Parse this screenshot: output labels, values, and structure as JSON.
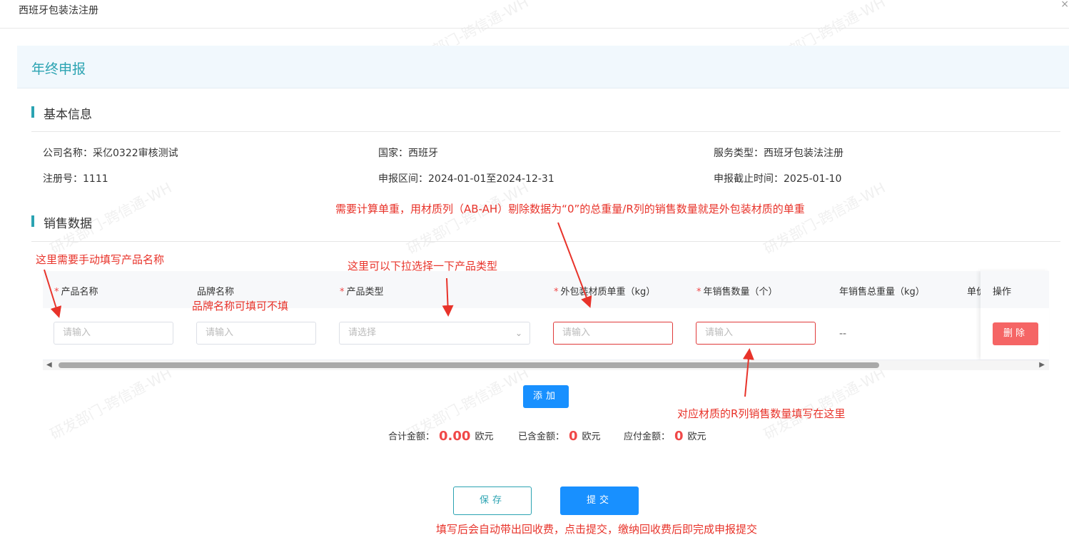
{
  "window": {
    "title": "西班牙包装法注册",
    "close_glyph": "×"
  },
  "banner": {
    "title": "年终申报"
  },
  "basic_info": {
    "heading": "基本信息",
    "company": "公司名称：采亿0322审核测试",
    "country": "国家：西班牙",
    "service_type": "服务类型：西班牙包装法注册",
    "reg_no": "注册号：1111",
    "period": "申报区间：2024-01-01至2024-12-31",
    "deadline": "申报截止时间：2025-01-10"
  },
  "sales": {
    "heading": "销售数据",
    "required_mark": "*",
    "columns": {
      "product_name": "产品名称",
      "brand_name": "品牌名称",
      "product_type": "产品类型",
      "unit_weight": "外包装材质单重（kg）",
      "annual_qty": "年销售数量（个）",
      "annual_total_weight": "年销售总重量（kg）",
      "unit_price_partial": "单价",
      "operation": "操作"
    },
    "row": {
      "product_name_placeholder": "请输入",
      "brand_name_placeholder": "请输入",
      "product_type_placeholder": "请选择",
      "unit_weight_placeholder": "请输入",
      "annual_qty_placeholder": "请输入",
      "total_weight_value": "--",
      "delete_label": "删除"
    },
    "add_label": "添加"
  },
  "totals": {
    "total_label": "合计金额：",
    "total_value": "0.00",
    "total_unit": "欧元",
    "included_label": "已含金额：",
    "included_value": "0",
    "included_unit": "欧元",
    "payable_label": "应付金额：",
    "payable_value": "0",
    "payable_unit": "欧元"
  },
  "actions": {
    "save_label": "保存",
    "submit_label": "提交"
  },
  "annotations": {
    "product_name": "这里需要手动填写产品名称",
    "brand_name": "品牌名称可填可不填",
    "product_type": "这里可以下拉选择一下产品类型",
    "unit_weight": "需要计算单重，用材质列（AB-AH）剔除数据为“0”的总重量/R列的销售数量就是外包装材质的单重",
    "annual_qty": "对应材质的R列销售数量填写在这里",
    "submit": "填写后会自动带出回收费，点击提交，缴纳回收费后即完成申报提交"
  },
  "watermark": "研发部门-跨信通-WH",
  "colors": {
    "accent": "#2ba3b2",
    "primary": "#1890ff",
    "danger": "#f56565",
    "annotation": "#e8332a"
  }
}
